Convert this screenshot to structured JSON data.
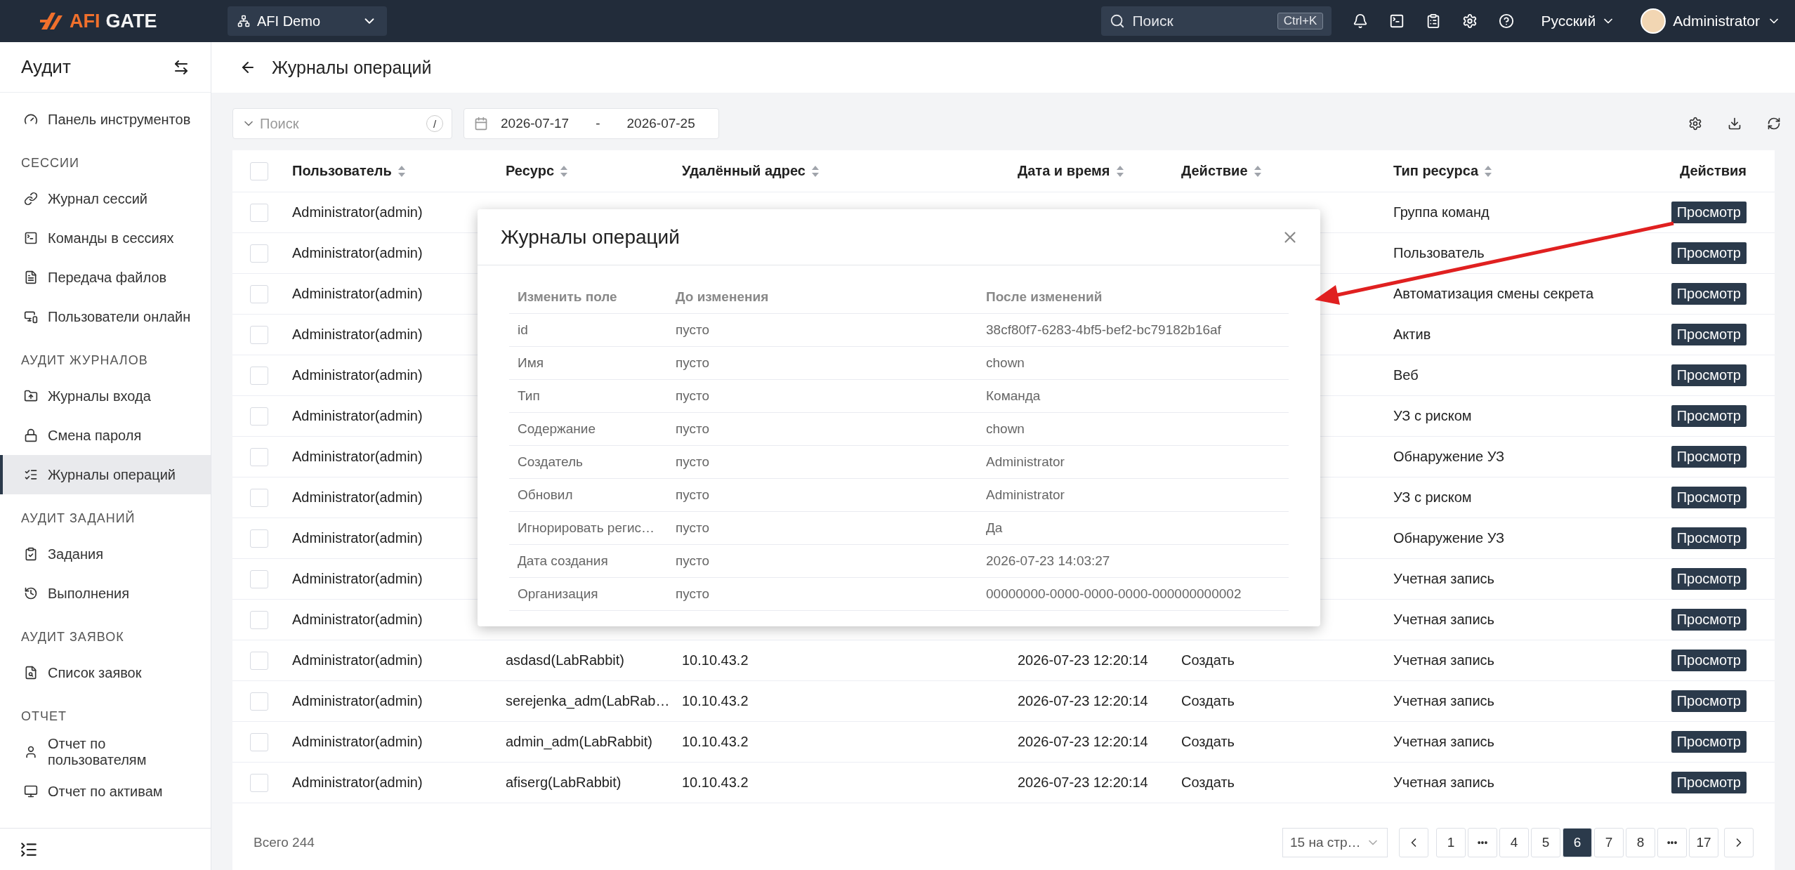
{
  "topbar": {
    "logo": {
      "brand": "AFI",
      "product": "GATE"
    },
    "workspace": "AFI Demo",
    "search": {
      "placeholder": "Поиск",
      "shortcut": "Ctrl+K"
    },
    "language": "Русский",
    "user": "Administrator"
  },
  "sidebar": {
    "title": "Аудит",
    "groups": [
      {
        "items": [
          {
            "label": "Панель инструментов",
            "selected": false
          }
        ]
      },
      {
        "heading": "СЕССИИ",
        "items": [
          {
            "label": "Журнал сессий",
            "selected": false
          },
          {
            "label": "Команды в сессиях",
            "selected": false
          },
          {
            "label": "Передача файлов",
            "selected": false
          },
          {
            "label": "Пользователи онлайн",
            "selected": false
          }
        ]
      },
      {
        "heading": "АУДИТ ЖУРНАЛОВ",
        "items": [
          {
            "label": "Журналы входа",
            "selected": false
          },
          {
            "label": "Смена пароля",
            "selected": false
          },
          {
            "label": "Журналы операций",
            "selected": true
          }
        ]
      },
      {
        "heading": "АУДИТ ЗАДАНИЙ",
        "items": [
          {
            "label": "Задания",
            "selected": false
          },
          {
            "label": "Выполнения",
            "selected": false
          }
        ]
      },
      {
        "heading": "АУДИТ ЗАЯВОК",
        "items": [
          {
            "label": "Список заявок",
            "selected": false
          }
        ]
      },
      {
        "heading": "ОТЧЕТ",
        "items": [
          {
            "label": "Отчет по пользователям",
            "selected": false
          },
          {
            "label": "Отчет по активам",
            "selected": false
          }
        ]
      }
    ]
  },
  "page": {
    "title": "Журналы операций"
  },
  "filters": {
    "search_placeholder": "Поиск",
    "search_shortcut": "/",
    "date_from": "2026-07-17",
    "date_separator": "-",
    "date_to": "2026-07-25"
  },
  "table": {
    "header_checked": false,
    "columns": [
      {
        "label": "Пользователь",
        "sortable": true
      },
      {
        "label": "Ресурс",
        "sortable": true
      },
      {
        "label": "Удалённый адрес",
        "sortable": true
      },
      {
        "label": "Дата и время",
        "sortable": true
      },
      {
        "label": "Действие",
        "sortable": true
      },
      {
        "label": "Тип ресурса",
        "sortable": true
      },
      {
        "label": "Действия",
        "sortable": false
      }
    ],
    "rows": [
      {
        "checked": false,
        "user": "Administrator(admin)",
        "resource_type": "Группа команд",
        "button": "Просмотр"
      },
      {
        "checked": false,
        "user": "Administrator(admin)",
        "resource_type": "Пользователь",
        "button": "Просмотр"
      },
      {
        "checked": false,
        "user": "Administrator(admin)",
        "resource_type": "Автоматизация смены секрета",
        "button": "Просмотр"
      },
      {
        "checked": false,
        "user": "Administrator(admin)",
        "resource_type": "Актив",
        "button": "Просмотр"
      },
      {
        "checked": false,
        "user": "Administrator(admin)",
        "resource_type": "Веб",
        "button": "Просмотр"
      },
      {
        "checked": false,
        "user": "Administrator(admin)",
        "resource_type": "УЗ с риском",
        "button": "Просмотр"
      },
      {
        "checked": false,
        "user": "Administrator(admin)",
        "resource_type": "Обнаружение УЗ",
        "button": "Просмотр"
      },
      {
        "checked": false,
        "user": "Administrator(admin)",
        "resource_type": "УЗ с риском",
        "button": "Просмотр"
      },
      {
        "checked": false,
        "user": "Administrator(admin)",
        "resource_type": "Обнаружение УЗ",
        "button": "Просмотр"
      },
      {
        "checked": false,
        "user": "Administrator(admin)",
        "resource_type": "Учетная запись",
        "button": "Просмотр"
      },
      {
        "checked": false,
        "user": "Administrator(admin)",
        "resource_type": "Учетная запись",
        "button": "Просмотр"
      },
      {
        "checked": false,
        "user": "Administrator(admin)",
        "resource": "asdasd(LabRabbit)",
        "address": "10.10.43.2",
        "datetime": "2026-07-23 12:20:14",
        "action": "Создать",
        "resource_type": "Учетная запись",
        "button": "Просмотр"
      },
      {
        "checked": false,
        "user": "Administrator(admin)",
        "resource": "serejenka_adm(LabRab…",
        "address": "10.10.43.2",
        "datetime": "2026-07-23 12:20:14",
        "action": "Создать",
        "resource_type": "Учетная запись",
        "button": "Просмотр"
      },
      {
        "checked": false,
        "user": "Administrator(admin)",
        "resource": "admin_adm(LabRabbit)",
        "address": "10.10.43.2",
        "datetime": "2026-07-23 12:20:14",
        "action": "Создать",
        "resource_type": "Учетная запись",
        "button": "Просмотр"
      },
      {
        "checked": false,
        "user": "Administrator(admin)",
        "resource": "afiserg(LabRabbit)",
        "address": "10.10.43.2",
        "datetime": "2026-07-23 12:20:14",
        "action": "Создать",
        "resource_type": "Учетная запись",
        "button": "Просмотр"
      }
    ]
  },
  "footer": {
    "total": "Всего 244",
    "page_size": "15 на стр…",
    "pages": [
      {
        "kind": "page",
        "label": "1",
        "selected": false
      },
      {
        "kind": "ellipsis",
        "label": "•••",
        "selected": false
      },
      {
        "kind": "page",
        "label": "4",
        "selected": false
      },
      {
        "kind": "page",
        "label": "5",
        "selected": false
      },
      {
        "kind": "page",
        "label": "6",
        "selected": true
      },
      {
        "kind": "page",
        "label": "7",
        "selected": false
      },
      {
        "kind": "page",
        "label": "8",
        "selected": false
      },
      {
        "kind": "ellipsis",
        "label": "•••",
        "selected": false
      },
      {
        "kind": "page",
        "label": "17",
        "selected": false
      }
    ]
  },
  "modal": {
    "title": "Журналы операций",
    "columns": [
      "Изменить поле",
      "До изменения",
      "После изменений"
    ],
    "rows": [
      {
        "field": "id",
        "before": "пусто",
        "after": "38cf80f7-6283-4bf5-bef2-bc79182b16af"
      },
      {
        "field": "Имя",
        "before": "пусто",
        "after": "chown"
      },
      {
        "field": "Тип",
        "before": "пусто",
        "after": "Команда"
      },
      {
        "field": "Содержание",
        "before": "пусто",
        "after": "chown"
      },
      {
        "field": "Создатель",
        "before": "пусто",
        "after": "Administrator"
      },
      {
        "field": "Обновил",
        "before": "пусто",
        "after": "Administrator"
      },
      {
        "field": "Игнорировать регис…",
        "before": "пусто",
        "after": "Да"
      },
      {
        "field": "Дата создания",
        "before": "пусто",
        "after": "2026-07-23 14:03:27"
      },
      {
        "field": "Организация",
        "before": "пусто",
        "after": "00000000-0000-0000-0000-000000000002"
      }
    ]
  }
}
